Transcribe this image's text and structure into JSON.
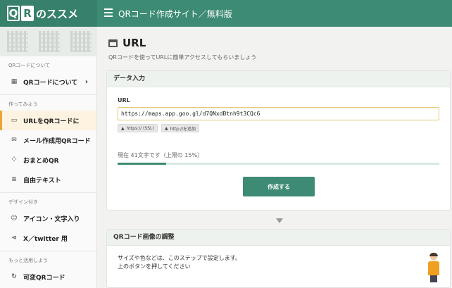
{
  "header": {
    "logo_q": "Q",
    "logo_r": "R",
    "logo_text": "のススメ",
    "site_title": "QRコード作成サイト／無料版"
  },
  "sidebar": {
    "sections": [
      {
        "label": "QRコードについて"
      },
      {
        "label": "作ってみよう"
      },
      {
        "label": "デザイン付き"
      },
      {
        "label": "もっと活用しよう"
      }
    ],
    "items": [
      {
        "label": "QRコードについて",
        "icon": "grid-icon"
      },
      {
        "label": "URLをQRコードに",
        "icon": "window-icon",
        "active": true
      },
      {
        "label": "メール作成用QRコード",
        "icon": "mail-icon"
      },
      {
        "label": "おまとめQR",
        "icon": "nodes-icon"
      },
      {
        "label": "自由テキスト",
        "icon": "lines-icon"
      },
      {
        "label": "アイコン・文字入り",
        "icon": "smile-icon"
      },
      {
        "label": "X／twitter 用",
        "icon": "share-icon"
      },
      {
        "label": "可変QRコード",
        "icon": "refresh-icon"
      }
    ]
  },
  "main": {
    "title": "URL",
    "subtitle": "QRコードを使ってURLに簡単アクセスしてもらいましょう",
    "data_card": {
      "header": "データ入力",
      "field_label": "URL",
      "url_value": "https://maps.app.goo.gl/d7QNxdBtnh9t3CQc6",
      "btn_https": "https:// (SSL)",
      "btn_http": "http://を追加",
      "count_text": "現在 41文字です（上限の 15%）",
      "progress": 0.15,
      "create_label": "作成する"
    },
    "adjust_card": {
      "header": "QRコード画像の調整",
      "line1": "サイズや色などは、このステップで設定します。",
      "line2": "上のボタンを押してください"
    }
  },
  "colors": {
    "brand": "#3d8b74",
    "accent": "#e8a735"
  }
}
